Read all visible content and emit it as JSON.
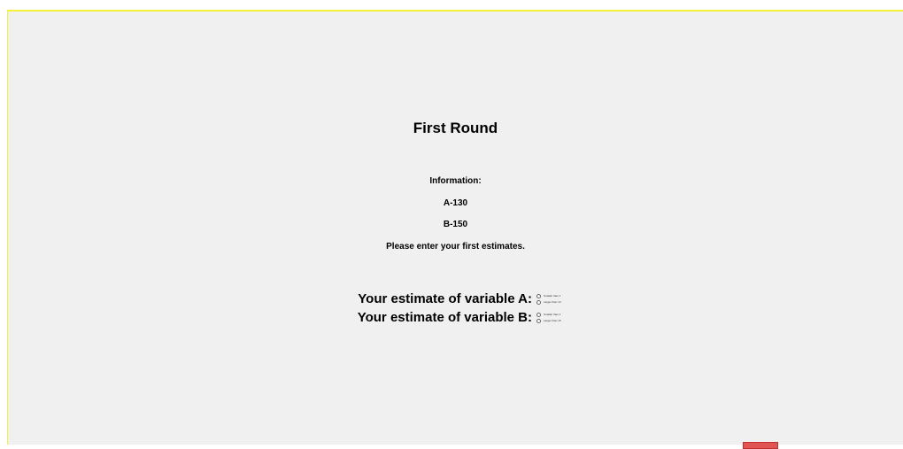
{
  "page": {
    "title": "First Round",
    "info_heading": "Information:",
    "info_a": "A-130",
    "info_b": "B-150",
    "instruction": "Please enter your first estimates."
  },
  "estimates": [
    {
      "label": "Your estimate of variable A:",
      "options": [
        "Smaller than 1",
        "Larger than 13"
      ]
    },
    {
      "label": "Your estimate of variable B:",
      "options": [
        "Smaller than 1",
        "Larger than 15"
      ]
    }
  ],
  "colors": {
    "frame_border": "#f5f13a",
    "background": "#f0f0f0",
    "submit": "#e05454"
  }
}
